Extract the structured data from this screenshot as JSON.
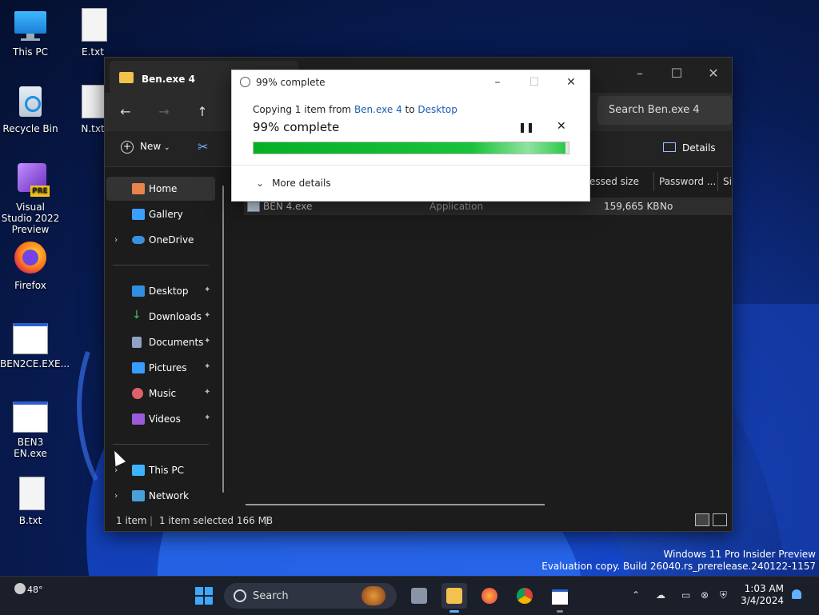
{
  "desktop": {
    "icons": [
      {
        "label": "This PC",
        "icon": "monitor-icon"
      },
      {
        "label": "E.txt",
        "icon": "text-file-icon"
      },
      {
        "label": "Recycle Bin",
        "icon": "recycle-bin-icon"
      },
      {
        "label": "N.txt",
        "icon": "text-file-icon"
      },
      {
        "label": "Visual Studio 2022 Preview",
        "icon": "visual-studio-icon",
        "badge": "PRE"
      },
      {
        "label": "Firefox",
        "icon": "firefox-icon"
      },
      {
        "label": "BEN2CE.EXE...",
        "icon": "app-window-icon"
      },
      {
        "label": "BEN3 EN.exe",
        "icon": "app-window-icon"
      },
      {
        "label": "B.txt",
        "icon": "text-file-icon"
      }
    ],
    "watermark": {
      "line1": "Windows 11 Pro Insider Preview",
      "line2": "Evaluation copy. Build 26040.rs_prerelease.240122-1157"
    }
  },
  "explorer": {
    "tab_title": "Ben.exe 4",
    "search_placeholder": "Search Ben.exe 4",
    "new_label": "New",
    "details_label": "Details",
    "sidebar": {
      "quick": [
        {
          "label": "Home",
          "icon": "home-icon",
          "selected": true
        },
        {
          "label": "Gallery",
          "icon": "gallery-icon"
        },
        {
          "label": "OneDrive",
          "icon": "cloud-icon",
          "expandable": true
        }
      ],
      "pinned": [
        {
          "label": "Desktop",
          "icon": "desktop-folder-icon"
        },
        {
          "label": "Downloads",
          "icon": "download-icon"
        },
        {
          "label": "Documents",
          "icon": "documents-icon"
        },
        {
          "label": "Pictures",
          "icon": "pictures-icon"
        },
        {
          "label": "Music",
          "icon": "music-icon"
        },
        {
          "label": "Videos",
          "icon": "videos-icon"
        }
      ],
      "system": [
        {
          "label": "This PC",
          "icon": "monitor-icon"
        },
        {
          "label": "Network",
          "icon": "network-icon"
        }
      ]
    },
    "columns": [
      "essed size",
      "Password ...",
      "Si"
    ],
    "rows": [
      {
        "name": "BEN 4.exe",
        "type": "Application",
        "size": "159,665 KB",
        "password": "No"
      }
    ],
    "status": {
      "count": "1 item",
      "selected": "1 item selected  166 MB"
    }
  },
  "dialog": {
    "title": "99% complete",
    "line_prefix": "Copying 1 item from ",
    "source": "Ben.exe 4",
    "line_mid": " to ",
    "destination": "Desktop",
    "headline": "99% complete",
    "progress": 0.99,
    "more_details": "More details"
  },
  "taskbar": {
    "weather": "48°",
    "search_label": "Search",
    "time": "1:03 AM",
    "date": "3/4/2024",
    "apps": [
      "task-view-icon",
      "file-explorer-icon",
      "firefox-icon",
      "chrome-icon",
      "app-window-icon"
    ]
  },
  "colors": {
    "accent": "#0067c0",
    "progress": "#06b025"
  }
}
